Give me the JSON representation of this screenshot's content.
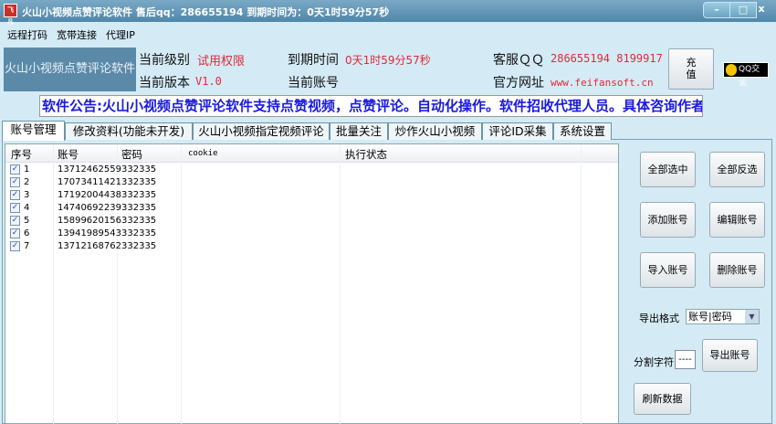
{
  "window": {
    "title": "火山小视频点赞评论软件 售后qq：286655194 到期时间为：0天1时59分57秒",
    "icon_text": "飞凡",
    "minimize": "–",
    "maximize": "□",
    "close": "x"
  },
  "menu": [
    "远程打码",
    "宽带连接",
    "代理IP"
  ],
  "header": {
    "logo_text": "火山小视频点赞评论软件",
    "level_label": "当前级别",
    "level_value": "试用权限",
    "expire_label": "到期时间",
    "expire_value": "0天1时59分57秒",
    "support_label": "客服ＱＱ",
    "support_value": "286655194 8199917",
    "version_label": "当前版本",
    "version_value": "V1.0",
    "account_label": "当前账号",
    "account_value": "",
    "site_label": "官方网址",
    "site_value": "www.feifansoft.cn",
    "recharge_button": "充\n值",
    "qq_button": "QQ交谈"
  },
  "notice": "软件公告:火山小视频点赞评论软件支持点赞视频，点赞评论。自动化操作。软件招收代理人员。具体咨询作者",
  "tabs": [
    "账号管理",
    "修改资料(功能未开发)",
    "火山小视频指定视频评论",
    "批量关注",
    "炒作火山小视频",
    "评论ID采集",
    "系统设置"
  ],
  "active_tab": "账号管理",
  "table": {
    "columns": [
      "序号",
      "账号",
      "密码",
      "cookie",
      "执行状态"
    ],
    "rows": [
      {
        "checked": true,
        "no": "1",
        "account": "13712462559",
        "password": "332335",
        "cookie": "",
        "status": ""
      },
      {
        "checked": true,
        "no": "2",
        "account": "17073411421",
        "password": "332335",
        "cookie": "",
        "status": ""
      },
      {
        "checked": true,
        "no": "3",
        "account": "17192004438",
        "password": "332335",
        "cookie": "",
        "status": ""
      },
      {
        "checked": true,
        "no": "4",
        "account": "14740692239",
        "password": "332335",
        "cookie": "",
        "status": ""
      },
      {
        "checked": true,
        "no": "5",
        "account": "15899620156",
        "password": "332335",
        "cookie": "",
        "status": ""
      },
      {
        "checked": true,
        "no": "6",
        "account": "13941989543",
        "password": "332335",
        "cookie": "",
        "status": ""
      },
      {
        "checked": true,
        "no": "7",
        "account": "13712168762",
        "password": "332335",
        "cookie": "",
        "status": ""
      }
    ]
  },
  "actions": {
    "select_all": "全部选中",
    "invert_select": "全部反选",
    "add_account": "添加账号",
    "edit_account": "编辑账号",
    "import_account": "导入账号",
    "delete_account": "删除账号",
    "export_format_label": "导出格式",
    "export_format_value": "账号|密码",
    "separator_label": "分割字符",
    "separator_value": "----",
    "export_account": "导出账号",
    "refresh": "刷新数据"
  },
  "colors": {
    "titlebar": "#4f86a9",
    "background": "#d4ebf5",
    "notice_text": "#1a1adc",
    "highlight_red": "#e0283a"
  }
}
